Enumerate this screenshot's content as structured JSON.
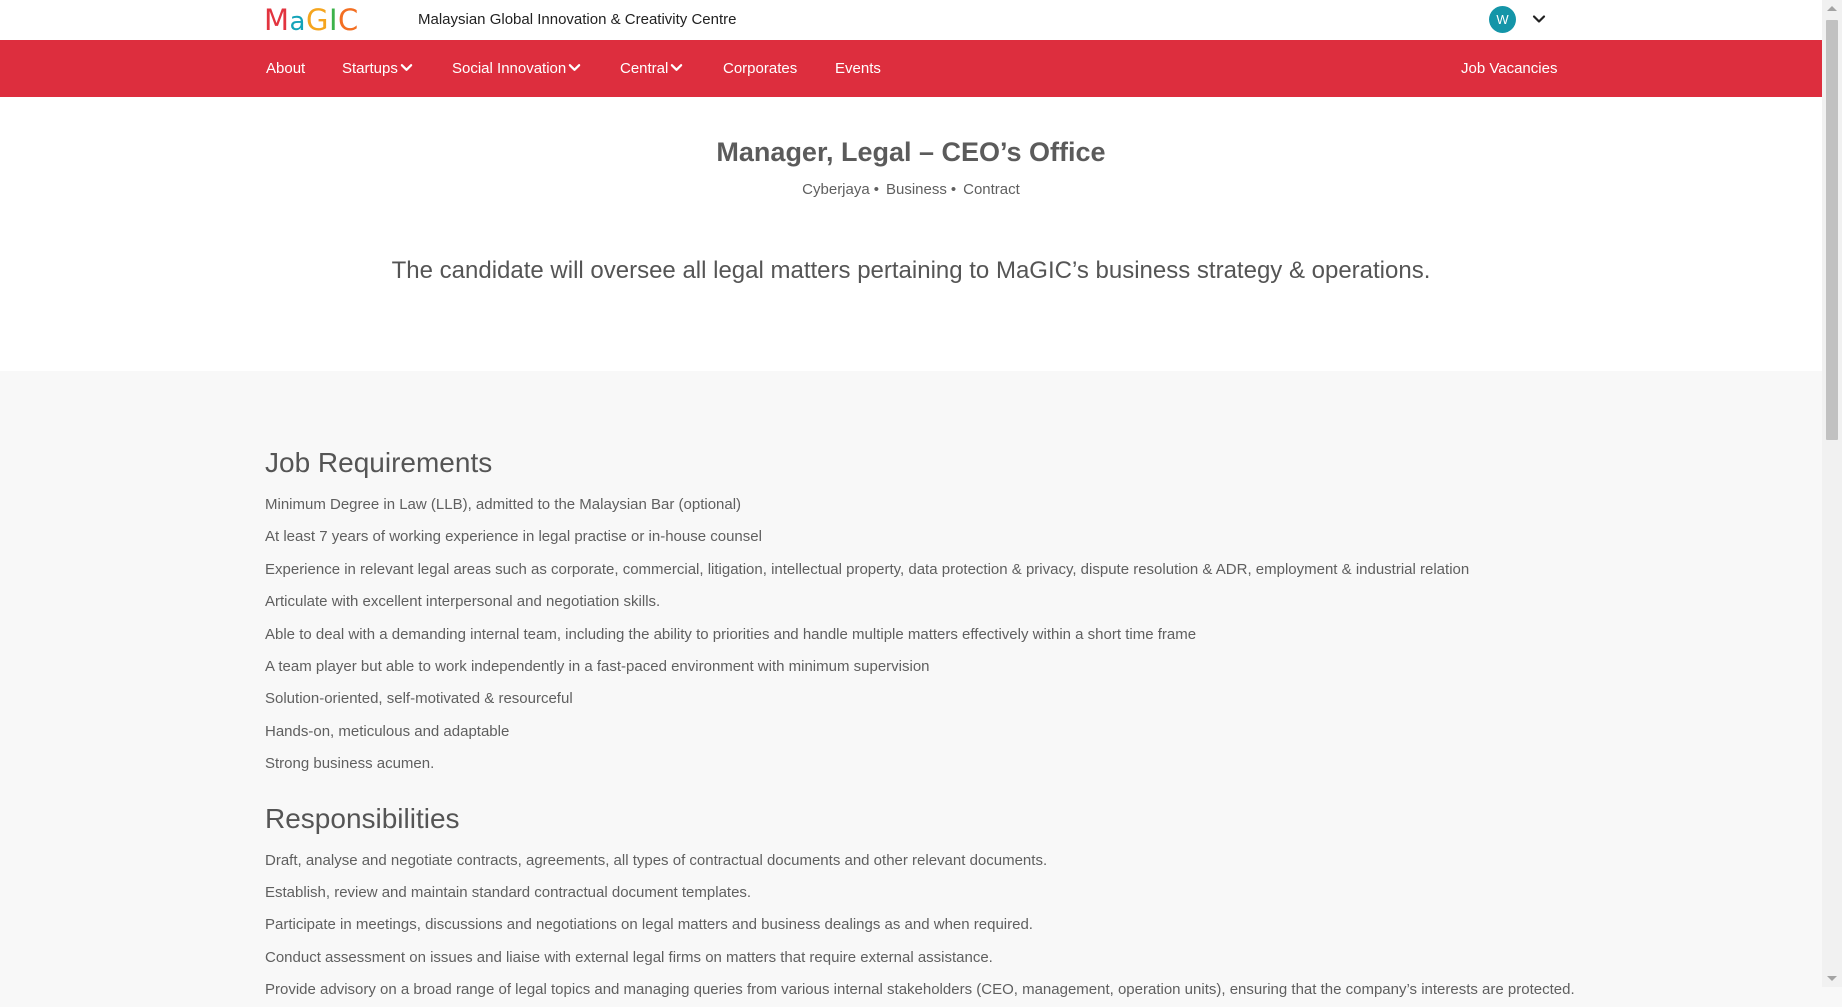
{
  "header": {
    "logo_text": "MaGIC",
    "org_name": "Malaysian Global Innovation & Creativity Centre",
    "avatar_initial": "W",
    "brand_colors": {
      "red": "#dd2e3e",
      "teal": "#1495a8"
    }
  },
  "nav": {
    "items": [
      {
        "label": "About",
        "has_dropdown": false
      },
      {
        "label": "Startups",
        "has_dropdown": true
      },
      {
        "label": "Social Innovation",
        "has_dropdown": true
      },
      {
        "label": "Central",
        "has_dropdown": true
      },
      {
        "label": "Corporates",
        "has_dropdown": false
      },
      {
        "label": "Events",
        "has_dropdown": false
      }
    ],
    "right_item": "Job Vacancies"
  },
  "job": {
    "title": "Manager, Legal – CEO’s Office",
    "location": "Cyberjaya",
    "department": "Business",
    "type": "Contract",
    "summary": "The candidate will oversee all legal matters pertaining to MaGIC’s business strategy & operations."
  },
  "requirements": {
    "heading": "Job Requirements",
    "items": [
      "Minimum Degree in Law (LLB), admitted to the Malaysian Bar (optional)",
      "At least 7 years of working experience in legal practise or in-house counsel",
      "Experience in relevant legal areas such as corporate, commercial, litigation, intellectual property, data protection & privacy, dispute resolution & ADR, employment & industrial relation",
      "Articulate with excellent interpersonal and negotiation skills.",
      "Able to deal with a demanding internal team, including the ability to priorities and handle multiple matters effectively within a short time frame",
      "A team player but able to work independently in a fast-paced environment with minimum supervision",
      "Solution-oriented, self-motivated & resourceful",
      "Hands-on, meticulous and adaptable",
      "Strong business acumen."
    ]
  },
  "responsibilities": {
    "heading": "Responsibilities",
    "items": [
      "Draft, analyse and negotiate contracts, agreements, all types of contractual documents and other relevant documents.",
      "Establish, review and maintain standard contractual document templates.",
      "Participate in meetings, discussions and negotiations on legal matters and business dealings as and when required.",
      "Conduct assessment on issues and liaise with external legal firms on matters that require external assistance.",
      "Provide advisory on a broad range of legal topics and managing queries from various internal stakeholders (CEO, management, operation units), ensuring that the company’s interests are protected."
    ]
  }
}
